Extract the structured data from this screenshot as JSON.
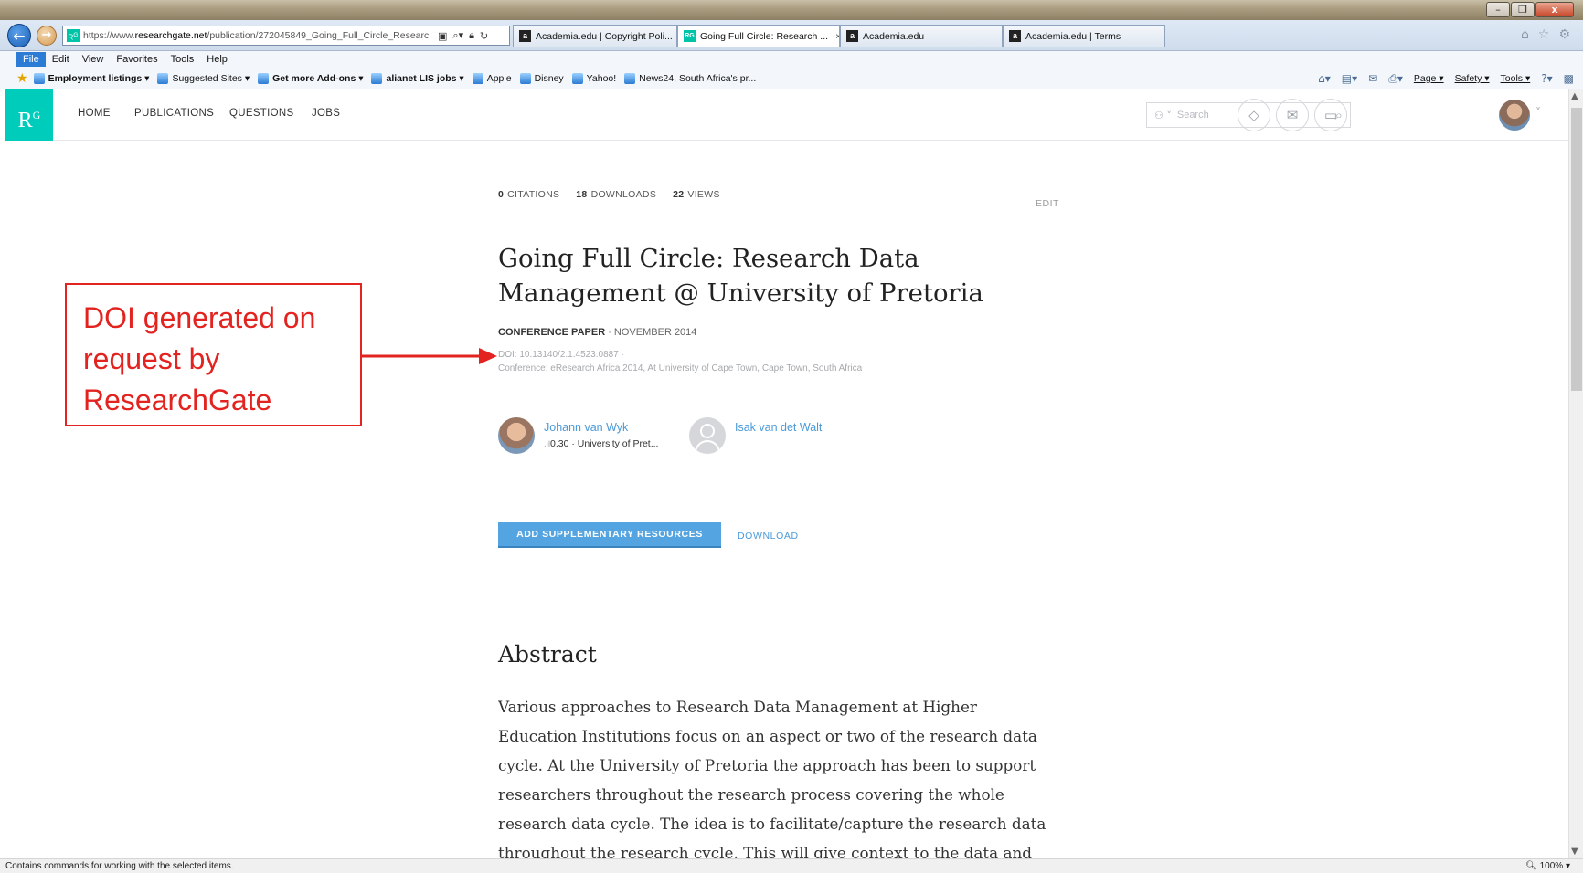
{
  "browser": {
    "url_prefix": "https://www.",
    "url_domain": "researchgate.net",
    "url_path": "/publication/272045849_Going_Full_Circle_Researc",
    "tabs": [
      {
        "label": "Academia.edu | Copyright Poli...",
        "icon": "academia-icon",
        "active": false
      },
      {
        "label": "Going Full Circle: Research ...",
        "icon": "researchgate-icon",
        "active": true
      },
      {
        "label": "Academia.edu",
        "icon": "academia-icon",
        "active": false
      },
      {
        "label": "Academia.edu | Terms",
        "icon": "academia-icon",
        "active": false
      }
    ],
    "menu": [
      "File",
      "Edit",
      "View",
      "Favorites",
      "Tools",
      "Help"
    ],
    "favorites": [
      {
        "label": "Employment listings ▾",
        "bold": true
      },
      {
        "label": "Suggested Sites ▾",
        "bold": false
      },
      {
        "label": "Get more Add-ons ▾",
        "bold": true
      },
      {
        "label": "alianet LIS jobs ▾",
        "bold": true
      },
      {
        "label": "Apple",
        "bold": false
      },
      {
        "label": "Disney",
        "bold": false
      },
      {
        "label": "Yahoo!",
        "bold": false
      },
      {
        "label": "News24, South Africa's pr...",
        "bold": false
      }
    ],
    "commands": [
      "Page ▾",
      "Safety ▾",
      "Tools ▾"
    ],
    "status_text": "Contains commands for working with the selected items.",
    "zoom": "100%"
  },
  "rg": {
    "logo": "R",
    "logo_sup": "G",
    "nav": [
      "HOME",
      "PUBLICATIONS",
      "QUESTIONS",
      "JOBS"
    ],
    "search_placeholder": "Search"
  },
  "publication": {
    "stats": {
      "citations_count": "0",
      "citations_label": "CITATIONS",
      "downloads_count": "18",
      "downloads_label": "DOWNLOADS",
      "views_count": "22",
      "views_label": "VIEWS"
    },
    "edit_label": "EDIT",
    "title": "Going Full Circle: Research Data Management @ University of Pretoria",
    "type": "CONFERENCE PAPER",
    "date": " · NOVEMBER 2014",
    "doi": "DOI: 10.13140/2.1.4523.0887 ·",
    "conference": "Conference: eResearch Africa 2014, At University of Cape Town, Cape Town, South Africa",
    "authors": [
      {
        "name": "Johann van Wyk",
        "score": "0.30",
        "affiliation": " · University of Pret..."
      },
      {
        "name": "Isak van det Walt"
      }
    ],
    "add_resources_label": "ADD SUPPLEMENTARY RESOURCES",
    "download_label": "DOWNLOAD",
    "abstract_heading": "Abstract",
    "abstract_text": "Various approaches to Research Data Management at Higher Education Institutions focus on an aspect or two of the research data cycle. At the University of Pretoria the approach has been to support researchers throughout the research process covering the whole research data cycle. The idea is to facilitate/capture the research data throughout the research cycle. This will give context to the data and will add provenance to the data."
  },
  "annotation": {
    "line1": "DOI generated on",
    "line2": "request by",
    "line3": "ResearchGate",
    "color": "#e3231f"
  }
}
